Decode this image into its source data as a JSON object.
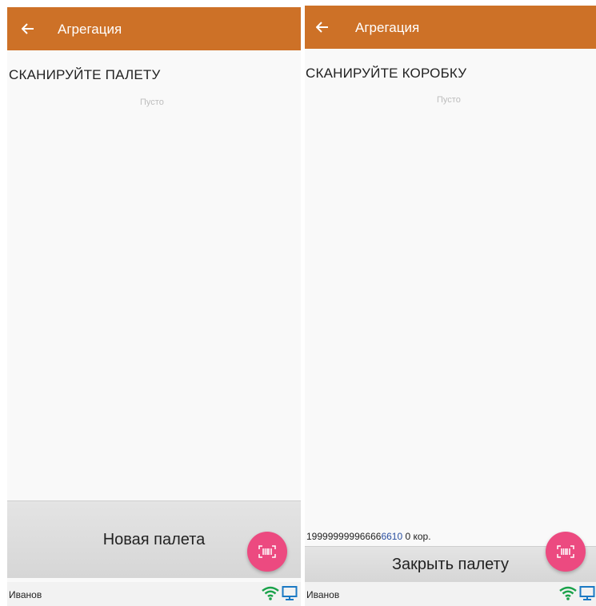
{
  "left": {
    "app_title": "Агрегация",
    "prompt": "СКАНИРУЙТЕ ПАЛЕТУ",
    "empty_text": "Пусто",
    "button_label": "Новая палета",
    "status_user": "Иванов"
  },
  "right": {
    "app_title": "Агрегация",
    "prompt": "СКАНИРУЙТЕ КОРОБКУ",
    "empty_text": "Пусто",
    "code_main": "19999999996666",
    "code_tail": "6610",
    "code_suffix": " 0 кор.",
    "button_label": "Закрыть палету",
    "status_user": "Иванов"
  },
  "icons": {
    "back": "arrow-left-icon",
    "scan": "barcode-scan-icon",
    "wifi": "wifi-icon",
    "monitor": "monitor-icon"
  },
  "colors": {
    "appbar": "#cd7127",
    "fab": "#ec4a80",
    "wifi": "#1aa24a",
    "monitor": "#1b79c4"
  }
}
